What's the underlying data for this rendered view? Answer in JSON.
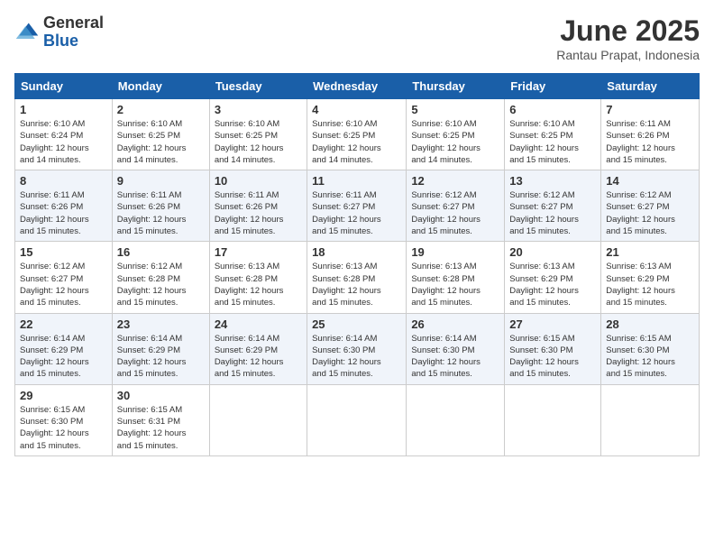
{
  "logo": {
    "general": "General",
    "blue": "Blue"
  },
  "title": "June 2025",
  "subtitle": "Rantau Prapat, Indonesia",
  "weekdays": [
    "Sunday",
    "Monday",
    "Tuesday",
    "Wednesday",
    "Thursday",
    "Friday",
    "Saturday"
  ],
  "weeks": [
    [
      {
        "day": "1",
        "sunrise": "6:10 AM",
        "sunset": "6:24 PM",
        "daylight": "12 hours and 14 minutes."
      },
      {
        "day": "2",
        "sunrise": "6:10 AM",
        "sunset": "6:25 PM",
        "daylight": "12 hours and 14 minutes."
      },
      {
        "day": "3",
        "sunrise": "6:10 AM",
        "sunset": "6:25 PM",
        "daylight": "12 hours and 14 minutes."
      },
      {
        "day": "4",
        "sunrise": "6:10 AM",
        "sunset": "6:25 PM",
        "daylight": "12 hours and 14 minutes."
      },
      {
        "day": "5",
        "sunrise": "6:10 AM",
        "sunset": "6:25 PM",
        "daylight": "12 hours and 14 minutes."
      },
      {
        "day": "6",
        "sunrise": "6:10 AM",
        "sunset": "6:25 PM",
        "daylight": "12 hours and 15 minutes."
      },
      {
        "day": "7",
        "sunrise": "6:11 AM",
        "sunset": "6:26 PM",
        "daylight": "12 hours and 15 minutes."
      }
    ],
    [
      {
        "day": "8",
        "sunrise": "6:11 AM",
        "sunset": "6:26 PM",
        "daylight": "12 hours and 15 minutes."
      },
      {
        "day": "9",
        "sunrise": "6:11 AM",
        "sunset": "6:26 PM",
        "daylight": "12 hours and 15 minutes."
      },
      {
        "day": "10",
        "sunrise": "6:11 AM",
        "sunset": "6:26 PM",
        "daylight": "12 hours and 15 minutes."
      },
      {
        "day": "11",
        "sunrise": "6:11 AM",
        "sunset": "6:27 PM",
        "daylight": "12 hours and 15 minutes."
      },
      {
        "day": "12",
        "sunrise": "6:12 AM",
        "sunset": "6:27 PM",
        "daylight": "12 hours and 15 minutes."
      },
      {
        "day": "13",
        "sunrise": "6:12 AM",
        "sunset": "6:27 PM",
        "daylight": "12 hours and 15 minutes."
      },
      {
        "day": "14",
        "sunrise": "6:12 AM",
        "sunset": "6:27 PM",
        "daylight": "12 hours and 15 minutes."
      }
    ],
    [
      {
        "day": "15",
        "sunrise": "6:12 AM",
        "sunset": "6:27 PM",
        "daylight": "12 hours and 15 minutes."
      },
      {
        "day": "16",
        "sunrise": "6:12 AM",
        "sunset": "6:28 PM",
        "daylight": "12 hours and 15 minutes."
      },
      {
        "day": "17",
        "sunrise": "6:13 AM",
        "sunset": "6:28 PM",
        "daylight": "12 hours and 15 minutes."
      },
      {
        "day": "18",
        "sunrise": "6:13 AM",
        "sunset": "6:28 PM",
        "daylight": "12 hours and 15 minutes."
      },
      {
        "day": "19",
        "sunrise": "6:13 AM",
        "sunset": "6:28 PM",
        "daylight": "12 hours and 15 minutes."
      },
      {
        "day": "20",
        "sunrise": "6:13 AM",
        "sunset": "6:29 PM",
        "daylight": "12 hours and 15 minutes."
      },
      {
        "day": "21",
        "sunrise": "6:13 AM",
        "sunset": "6:29 PM",
        "daylight": "12 hours and 15 minutes."
      }
    ],
    [
      {
        "day": "22",
        "sunrise": "6:14 AM",
        "sunset": "6:29 PM",
        "daylight": "12 hours and 15 minutes."
      },
      {
        "day": "23",
        "sunrise": "6:14 AM",
        "sunset": "6:29 PM",
        "daylight": "12 hours and 15 minutes."
      },
      {
        "day": "24",
        "sunrise": "6:14 AM",
        "sunset": "6:29 PM",
        "daylight": "12 hours and 15 minutes."
      },
      {
        "day": "25",
        "sunrise": "6:14 AM",
        "sunset": "6:30 PM",
        "daylight": "12 hours and 15 minutes."
      },
      {
        "day": "26",
        "sunrise": "6:14 AM",
        "sunset": "6:30 PM",
        "daylight": "12 hours and 15 minutes."
      },
      {
        "day": "27",
        "sunrise": "6:15 AM",
        "sunset": "6:30 PM",
        "daylight": "12 hours and 15 minutes."
      },
      {
        "day": "28",
        "sunrise": "6:15 AM",
        "sunset": "6:30 PM",
        "daylight": "12 hours and 15 minutes."
      }
    ],
    [
      {
        "day": "29",
        "sunrise": "6:15 AM",
        "sunset": "6:30 PM",
        "daylight": "12 hours and 15 minutes."
      },
      {
        "day": "30",
        "sunrise": "6:15 AM",
        "sunset": "6:31 PM",
        "daylight": "12 hours and 15 minutes."
      },
      null,
      null,
      null,
      null,
      null
    ]
  ]
}
